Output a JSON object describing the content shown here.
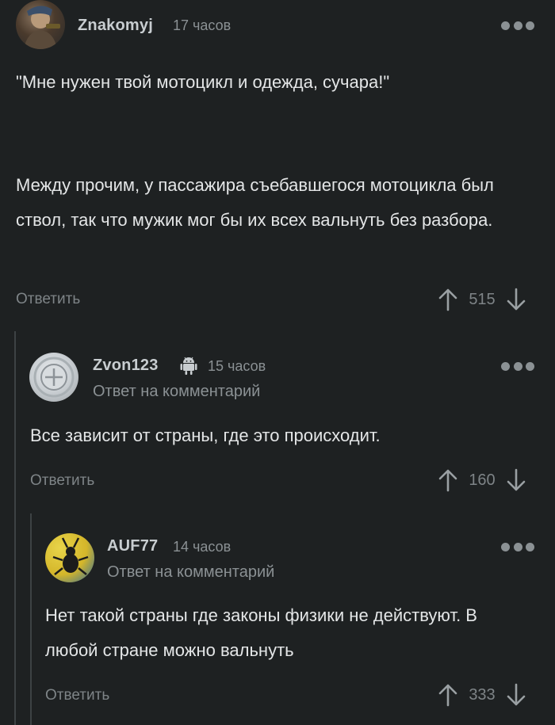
{
  "comments": [
    {
      "username": "Znakomyj",
      "time": "17 часов",
      "reply_to": "",
      "paragraphs": [
        "\"Мне нужен твой мотоцикл и одежда, сучара!\"",
        "Между прочим, у пассажира съебавшегося мотоцикла был ствол, так что мужик мог бы их всех вальнуть без разбора."
      ],
      "reply_label": "Ответить",
      "rating": "515"
    },
    {
      "username": "Zvon123",
      "time": "15 часов",
      "reply_to": "Ответ на комментарий",
      "paragraphs": [
        "Все зависит от страны, где это происходит."
      ],
      "reply_label": "Ответить",
      "rating": "160",
      "platform_icon": "android-icon"
    },
    {
      "username": "AUF77",
      "time": "14 часов",
      "reply_to": "Ответ на комментарий",
      "paragraphs": [
        "Нет такой страны где законы физики не действуют. В любой стране можно вальнуть"
      ],
      "reply_label": "Ответить",
      "rating": "333"
    }
  ],
  "colors": {
    "background": "#1e2122",
    "text": "#e4e6e7",
    "muted": "#8b9194",
    "thread_line": "#3d4244"
  }
}
